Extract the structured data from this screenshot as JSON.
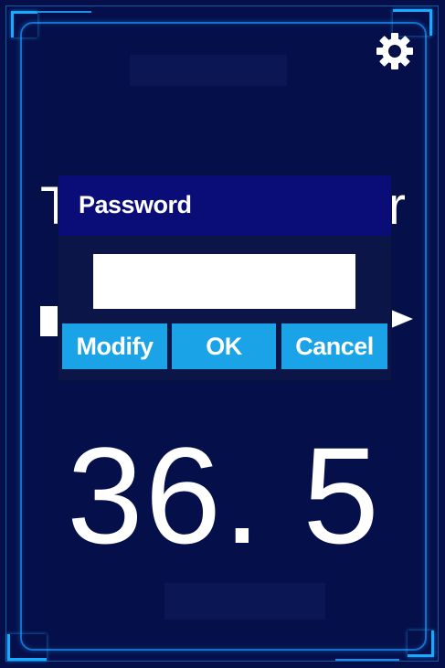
{
  "background": {
    "title_left": "T",
    "title_right": "r",
    "temperature": "36. 5"
  },
  "dialog": {
    "title": "Password",
    "password_value": "",
    "buttons": {
      "modify": "Modify",
      "ok": "OK",
      "cancel": "Cancel"
    }
  },
  "icons": {
    "settings": "gear-icon"
  },
  "colors": {
    "background": "#05104a",
    "frame_accent": "#19a9ff",
    "dialog_title_bg": "#0a0d78",
    "button_bg": "#1ba3e8"
  }
}
